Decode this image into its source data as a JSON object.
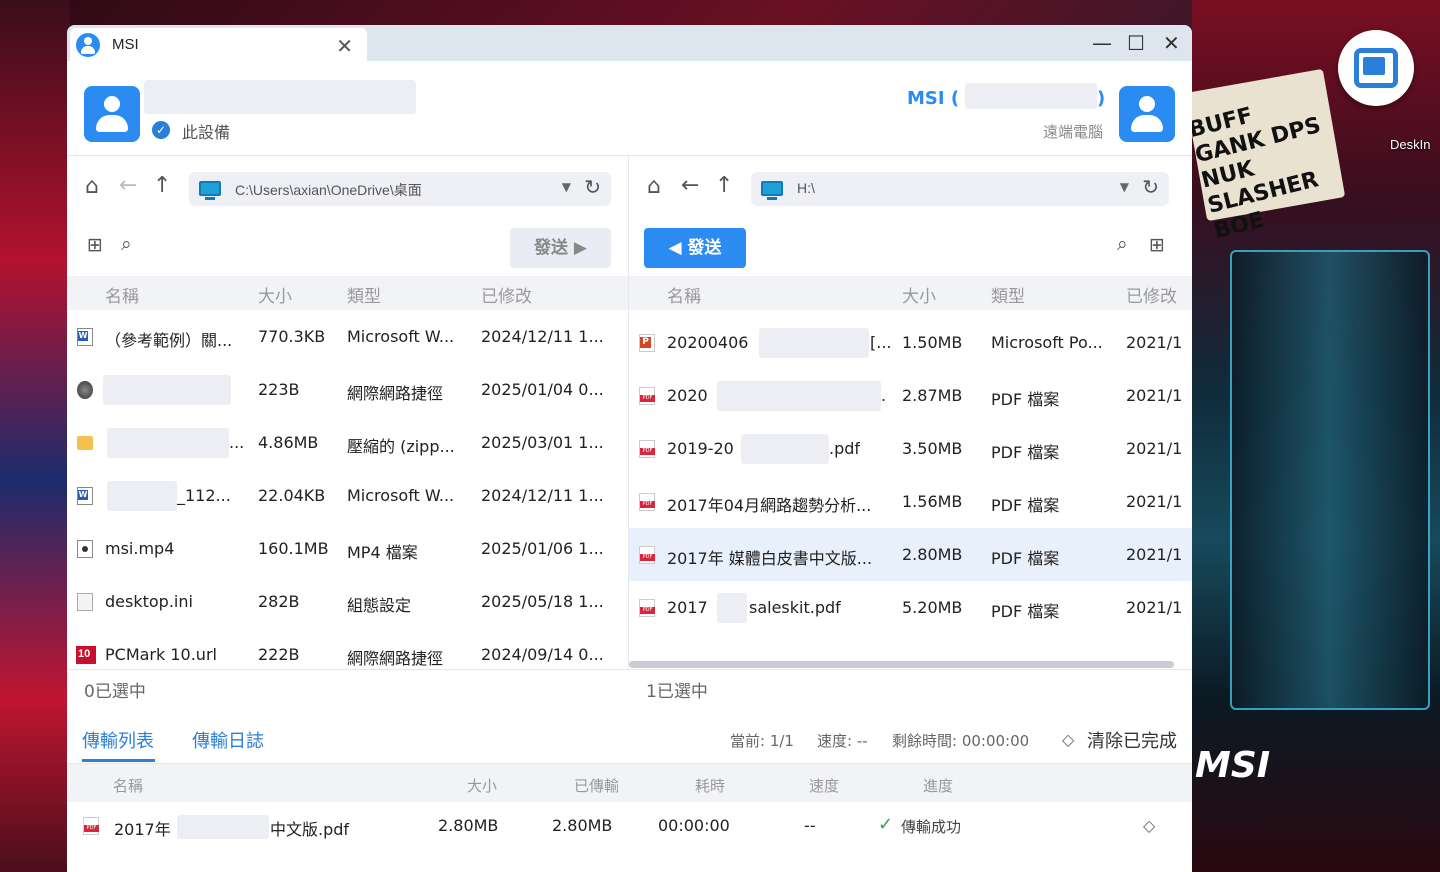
{
  "window": {
    "tab_title": "MSI",
    "close_glyph": "✕",
    "minimize_glyph": "—",
    "maximize_glyph": "☐",
    "window_close_glyph": "✕"
  },
  "local": {
    "device_label": "此設備",
    "path": "C:\\Users\\axian\\OneDrive\\桌面",
    "send_label": "發送 ▶",
    "selected_status": "0已選中"
  },
  "remote": {
    "name_prefix": "MSI (",
    "name_suffix": ")",
    "device_label": "遠端電腦",
    "path": "H:\\",
    "send_label": "◀ 發送",
    "selected_status": "1已選中"
  },
  "columns": {
    "name": "名稱",
    "size": "大小",
    "type": "類型",
    "modified": "已修改"
  },
  "local_files": [
    {
      "name": "（參考範例）關...",
      "size": "770.3KB",
      "type": "Microsoft W...",
      "modified": "2024/12/11 1...",
      "icon": "word-doc-icon"
    },
    {
      "name": "",
      "size": "223B",
      "type": "網際網路捷徑",
      "modified": "2025/01/04 0...",
      "icon": "internet-shortcut-icon"
    },
    {
      "name": "...",
      "size": "4.86MB",
      "type": "壓縮的 (zipp...",
      "modified": "2025/03/01 1...",
      "icon": "zip-folder-icon"
    },
    {
      "name": "_112...",
      "size": "22.04KB",
      "type": "Microsoft W...",
      "modified": "2024/12/11 1...",
      "icon": "word-doc-icon"
    },
    {
      "name": "msi.mp4",
      "size": "160.1MB",
      "type": "MP4 檔案",
      "modified": "2025/01/06 1...",
      "icon": "video-file-icon"
    },
    {
      "name": "desktop.ini",
      "size": "282B",
      "type": "組態設定",
      "modified": "2025/05/18 1...",
      "icon": "ini-file-icon"
    },
    {
      "name": "PCMark 10.url",
      "size": "222B",
      "type": "網際網路捷徑",
      "modified": "2024/09/14 0...",
      "icon": "pcmark-icon"
    }
  ],
  "remote_files": [
    {
      "name": "20200406",
      "name_tail": "[...",
      "size": "1.50MB",
      "type": "Microsoft Po...",
      "modified": "2021/1",
      "icon": "ppt-file-icon"
    },
    {
      "name": "2020",
      "name_tail": ".",
      "size": "2.87MB",
      "type": "PDF 檔案",
      "modified": "2021/1",
      "icon": "pdf-file-icon"
    },
    {
      "name": "2019-20",
      "name_tail": ".pdf",
      "size": "3.50MB",
      "type": "PDF 檔案",
      "modified": "2021/1",
      "icon": "pdf-file-icon"
    },
    {
      "name": "2017年04月網路趨勢分析...",
      "name_tail": "",
      "size": "1.56MB",
      "type": "PDF 檔案",
      "modified": "2021/1",
      "icon": "pdf-file-icon"
    },
    {
      "name": "2017年 媒體白皮書中文版...",
      "name_tail": "",
      "size": "2.80MB",
      "type": "PDF 檔案",
      "modified": "2021/1",
      "icon": "pdf-file-icon"
    },
    {
      "name": "2017",
      "name_tail": "saleskit.pdf",
      "size": "5.20MB",
      "type": "PDF 檔案",
      "modified": "2021/1",
      "icon": "pdf-file-icon"
    }
  ],
  "transfer": {
    "tab_list": "傳輸列表",
    "tab_log": "傳輸日誌",
    "current": "當前: 1/1",
    "speed": "速度: --",
    "remaining": "剩餘時間: 00:00:00",
    "clear": "清除已完成",
    "headers": {
      "name": "名稱",
      "size": "大小",
      "transferred": "已傳輸",
      "elapsed": "耗時",
      "speed": "速度",
      "progress": "進度"
    },
    "row": {
      "name_a": "2017年",
      "name_b": "中文版.pdf",
      "size": "2.80MB",
      "transferred": "2.80MB",
      "elapsed": "00:00:00",
      "speed": "--",
      "progress": "傳輸成功"
    }
  },
  "desktop": {
    "app_label": "DeskIn",
    "sign_text": "BUFF GANK DPS NUK SLASHER BOE",
    "brand": "MSI"
  }
}
